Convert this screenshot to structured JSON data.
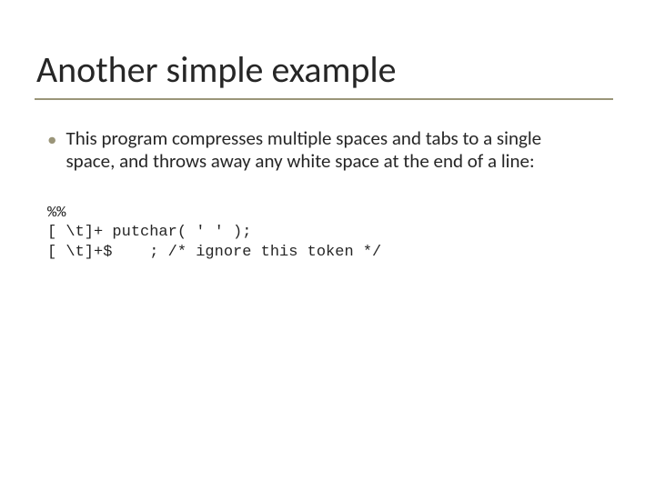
{
  "title": "Another simple example",
  "bullet": {
    "marker": "•",
    "text": "This program compresses multiple spaces and tabs to a single space, and throws away any white space at the end of a line:"
  },
  "code": {
    "line1": "%%",
    "line2": "[ \\t]+ putchar( ' ' );",
    "line3": "[ \\t]+$    ; /* ignore this token */"
  }
}
